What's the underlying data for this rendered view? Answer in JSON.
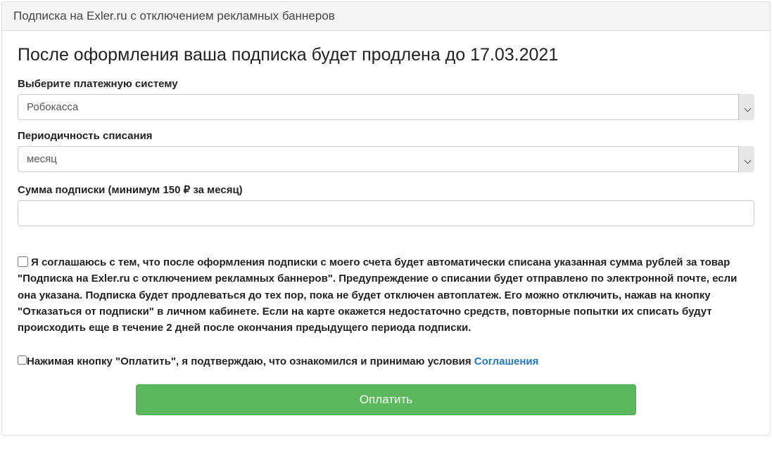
{
  "panel": {
    "header": "Подписка на Exler.ru с отключением рекламных баннеров"
  },
  "title": "После оформления ваша подписка будет продлена до 17.03.2021",
  "form": {
    "payment_system": {
      "label": "Выберите платежную систему",
      "selected": "Робокасса"
    },
    "period": {
      "label": "Периодичность списания",
      "selected": "месяц"
    },
    "amount": {
      "label": "Сумма подписки (минимум 150 ₽ за месяц)",
      "value": ""
    }
  },
  "agreement1": "Я соглашаюсь с тем, что после оформления подписки с моего счета будет автоматически списана указанная сумма рублей за товар \"Подписка на Exler.ru с отключением рекламных баннеров\". Предупреждение о списании будет отправлено по электронной почте, если она указана. Подписка будет продлеваться до тех пор, пока не будет отключен автоплатеж. Его можно отключить, нажав на кнопку \"Отказаться от подписки\" в личном кабинете. Если на карте окажется недостаточно средств, повторные попытки их списать будут происходить еще в течение 2 дней после окончания предыдущего периода подписки.",
  "agreement2_prefix": "Нажимая кнопку \"Оплатить\", я подтверждаю, что ознакомился и принимаю условия ",
  "agreement2_link": "Соглашения",
  "submit": "Оплатить"
}
